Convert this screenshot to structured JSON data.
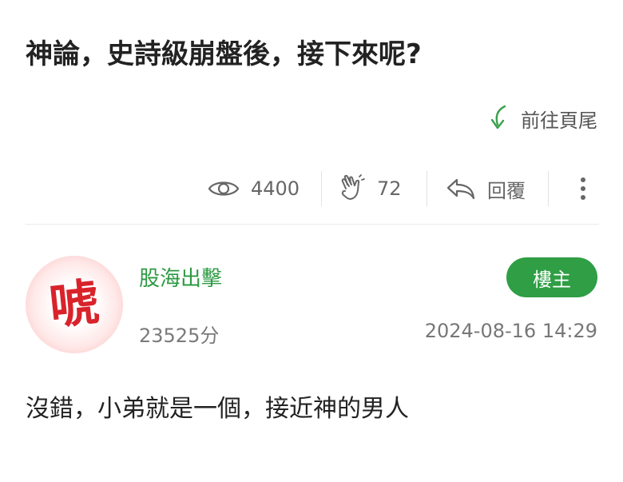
{
  "post": {
    "title": "神論，史詩級崩盤後，接下來呢?",
    "goto_bottom_label": "前往頁尾"
  },
  "stats": {
    "views": "4400",
    "likes": "72",
    "reply_label": "回覆"
  },
  "author": {
    "name": "股海出擊",
    "score": "23525分",
    "badge": "樓主",
    "avatar_text": "唬",
    "timestamp": "2024-08-16 14:29"
  },
  "content": {
    "body": "沒錯，小弟就是一個，接近神的男人"
  },
  "colors": {
    "accent_green": "#2f9e44",
    "username_green": "#2d9a43",
    "avatar_red": "#d9232b"
  }
}
